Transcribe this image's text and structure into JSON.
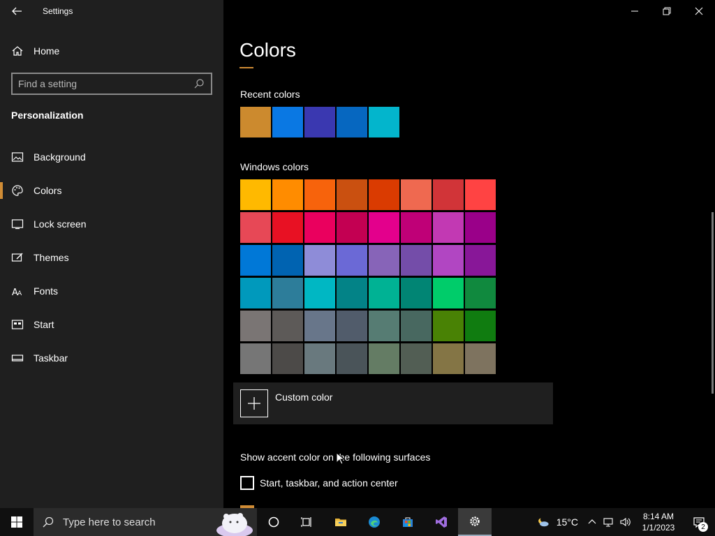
{
  "window": {
    "title": "Settings"
  },
  "sidebar": {
    "home_label": "Home",
    "search_placeholder": "Find a setting",
    "section_title": "Personalization",
    "items": [
      {
        "label": "Background",
        "icon": "picture-icon"
      },
      {
        "label": "Colors",
        "icon": "palette-icon",
        "selected": true
      },
      {
        "label": "Lock screen",
        "icon": "lock-screen-icon"
      },
      {
        "label": "Themes",
        "icon": "themes-icon"
      },
      {
        "label": "Fonts",
        "icon": "fonts-icon"
      },
      {
        "label": "Start",
        "icon": "start-icon"
      },
      {
        "label": "Taskbar",
        "icon": "taskbar-icon"
      }
    ]
  },
  "main": {
    "title": "Colors",
    "accent": "#d08c35",
    "recent_label": "Recent colors",
    "recent_colors": [
      "#cc8a2e",
      "#0a78e3",
      "#3a38b0",
      "#0667c0",
      "#03b5cc"
    ],
    "windows_label": "Windows colors",
    "windows_colors": [
      [
        "#ffb900",
        "#ff8c00",
        "#f7630c",
        "#ca5010",
        "#da3b01",
        "#ef6950",
        "#d13438",
        "#ff4343"
      ],
      [
        "#e74856",
        "#e81123",
        "#ea005e",
        "#c30052",
        "#e3008c",
        "#bf0077",
        "#c239b3",
        "#9a0089"
      ],
      [
        "#0078d7",
        "#0063b1",
        "#8e8cd8",
        "#6b69d6",
        "#8764b8",
        "#744da9",
        "#b146c2",
        "#881798"
      ],
      [
        "#0099bc",
        "#2d7d9a",
        "#00b7c3",
        "#038387",
        "#00b294",
        "#018574",
        "#00cc6a",
        "#10893e"
      ],
      [
        "#7a7574",
        "#5d5a58",
        "#68768a",
        "#515c6b",
        "#567c73",
        "#486860",
        "#498205",
        "#107c10"
      ],
      [
        "#767676",
        "#4c4a48",
        "#69797e",
        "#4a5459",
        "#647c64",
        "#525e54",
        "#847545",
        "#7e735f"
      ]
    ],
    "custom_color_label": "Custom color",
    "accent_surfaces_label": "Show accent color on the following surfaces",
    "checkbox_label": "Start, taskbar, and action center",
    "checkbox_checked": false
  },
  "taskbar": {
    "search_placeholder": "Type here to search",
    "apps": [
      "cortana-icon",
      "task-view-icon",
      "file-explorer-icon",
      "edge-icon",
      "store-icon",
      "visual-studio-icon",
      "settings-icon"
    ],
    "temperature": "15°C",
    "time": "8:14 AM",
    "date": "1/1/2023",
    "notification_count": "2"
  }
}
